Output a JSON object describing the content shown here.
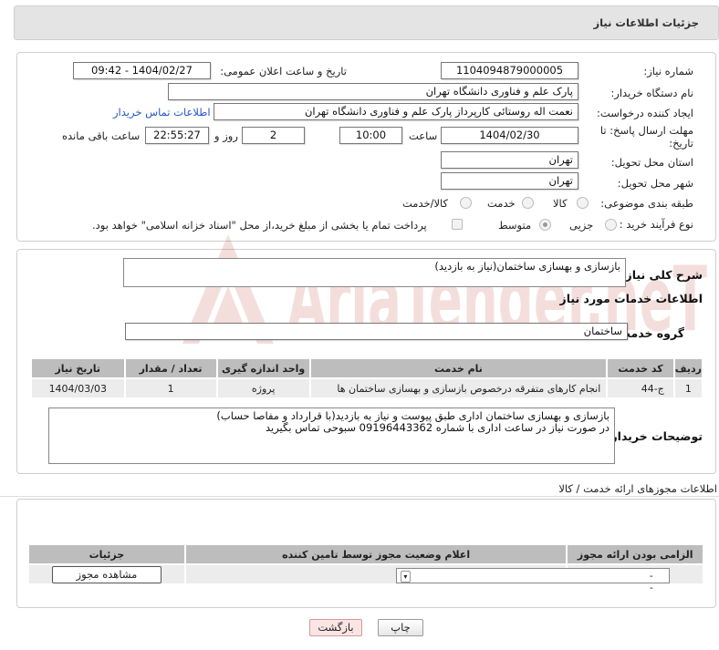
{
  "header": {
    "title": "جزئیات اطلاعات نیاز"
  },
  "form": {
    "need_number_label": "شماره نیاز:",
    "need_number_value": "1104094879000005",
    "announce_label": "تاریخ و ساعت اعلان عمومی:",
    "announce_value": "1404/02/27 - 09:42",
    "buyer_org_label": "نام دستگاه خریدار:",
    "buyer_org_value": "پارک علم و فناوری دانشگاه تهران",
    "creator_label": "ایجاد کننده درخواست:",
    "creator_value": "نعمت اله روستائی کارپرداز پارک علم و فناوری دانشگاه تهران",
    "buyer_contact_link": "اطلاعات تماس خریدار",
    "deadline_label_1": "مهلت ارسال پاسخ: تا",
    "deadline_label_2": "تاریخ:",
    "deadline_date": "1404/02/30",
    "time_label": "ساعت",
    "deadline_time": "10:00",
    "days_value": "2",
    "days_label": "روز و",
    "remaining_time": "22:55:27",
    "remaining_label": "ساعت باقی مانده",
    "province_label": "استان محل تحویل:",
    "province_value": "تهران",
    "city_label": "شهر محل تحویل:",
    "city_value": "تهران",
    "category_label": "طبقه بندی موضوعی:",
    "category_options": [
      "کالا",
      "خدمت",
      "کالا/خدمت"
    ],
    "process_label": "نوع فرآیند خرید :",
    "process_options": [
      "جزیی",
      "متوسط"
    ],
    "payment_note": "پرداخت تمام یا بخشی از مبلغ خرید،از محل \"اسناد خزانه اسلامی\" خواهد بود."
  },
  "details": {
    "summary_label": "شرح کلی نیاز:",
    "summary_value": "بازسازی و بهسازی ساختمان(نیاز به بازدید)",
    "services_heading": "اطلاعات خدمات مورد نیاز",
    "service_group_label": "گروه خدمت:",
    "service_group_value": "ساختمان",
    "table_headers": [
      "ردیف",
      "کد خدمت",
      "نام خدمت",
      "واحد اندازه گیری",
      "تعداد / مقدار",
      "تاریخ نیاز"
    ],
    "table_rows": [
      [
        "1",
        "ج-44",
        "انجام کارهای متفرقه درخصوص بازسازی و بهسازی ساختمان ها",
        "پروژه",
        "1",
        "1404/03/03"
      ]
    ],
    "buyer_notes_label": "توضیحات خریدار:",
    "buyer_notes_line1": "بازسازی و بهسازی ساختمان اداری طبق پیوست و نیاز به بازدید(با قرارداد و مفاصا حساب)",
    "buyer_notes_line2": "در صورت نیاز در ساعت اداری با شماره 09196443362 سبوحی تماس بگیرید"
  },
  "permits": {
    "section_title": "اطلاعات مجوزهای ارائه خدمت / کالا",
    "headers": [
      "الزامی بودن ارائه مجوز",
      "اعلام وضعیت مجوز توسط تامین کننده",
      "جزئیات"
    ],
    "select_value": "--",
    "view_button": "مشاهده مجوز"
  },
  "actions": {
    "print": "چاپ",
    "back": "بازگشت"
  },
  "watermark": {
    "text": "AriaTender.neT",
    "color": "#c0392b"
  }
}
